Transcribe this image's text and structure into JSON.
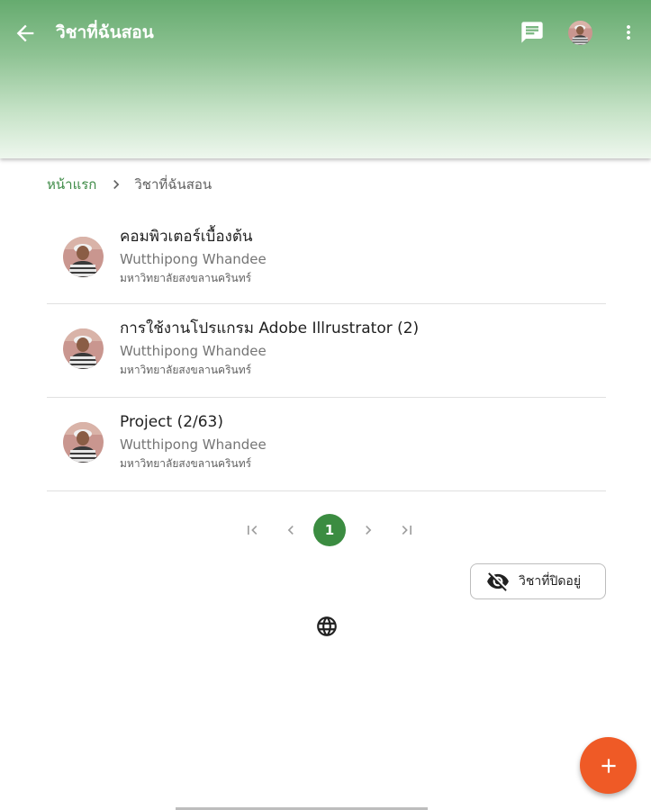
{
  "header": {
    "title": "วิชาที่ฉันสอน",
    "back_icon": "arrow-back-icon",
    "message_icon": "message-icon",
    "more_icon": "more-vert-icon",
    "gradient_colors": [
      "#66ab6f",
      "#eef7ee"
    ]
  },
  "breadcrumb": {
    "home": "หน้าแรก",
    "current": "วิชาที่ฉันสอน"
  },
  "courses": [
    {
      "title": "คอมพิวเตอร์เบื้องต้น",
      "teacher": "Wutthipong Whandee",
      "school": "มหาวิทยาลัยสงขลานครินทร์"
    },
    {
      "title": "การใช้งานโปรแกรม Adobe Illrustrator (2)",
      "teacher": "Wutthipong Whandee",
      "school": "มหาวิทยาลัยสงขลานครินทร์"
    },
    {
      "title": "Project (2/63)",
      "teacher": "Wutthipong Whandee",
      "school": "มหาวิทยาลัยสงขลานครินทร์"
    }
  ],
  "pagination": {
    "current_page": "1",
    "accent_color": "#3b8c41"
  },
  "closed_button": {
    "label": "วิชาที่ปิดอยู่",
    "icon": "visibility-off-icon"
  },
  "globe_icon": "globe-icon",
  "fab": {
    "icon": "plus-icon",
    "color": "#ef5a26"
  }
}
